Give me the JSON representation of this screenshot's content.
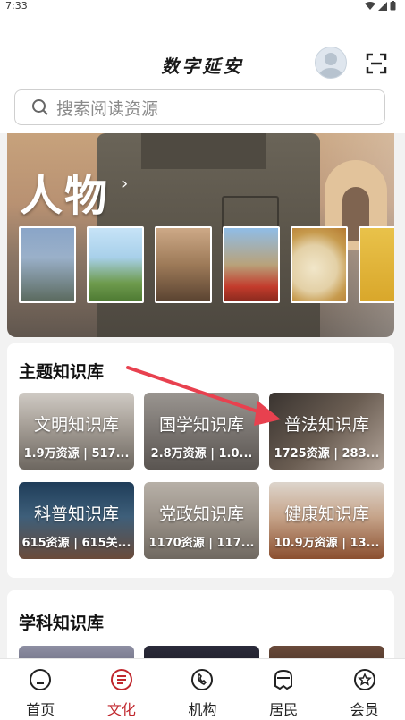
{
  "status_bar": {
    "time": "7:33"
  },
  "header": {
    "logo_text": "数字延安",
    "search_placeholder": "搜索阅读资源"
  },
  "banner": {
    "title": "人物",
    "thumbnails": [
      "portrait",
      "pagoda-hill",
      "cave-room",
      "folk-dance",
      "steamed-buns",
      "millet"
    ]
  },
  "theme_section": {
    "title": "主题知识库",
    "items": [
      {
        "name": "文明知识库",
        "meta": "1.9万资源 | 517..."
      },
      {
        "name": "国学知识库",
        "meta": "2.8万资源 | 1.0..."
      },
      {
        "name": "普法知识库",
        "meta": "1725资源 | 283..."
      },
      {
        "name": "科普知识库",
        "meta": "615资源 | 615关..."
      },
      {
        "name": "党政知识库",
        "meta": "1170资源 | 117..."
      },
      {
        "name": "健康知识库",
        "meta": "10.9万资源 | 13..."
      }
    ]
  },
  "subject_section": {
    "title": "学科知识库"
  },
  "tabbar": {
    "items": [
      {
        "label": "首页",
        "icon": "home-icon",
        "active": false
      },
      {
        "label": "文化",
        "icon": "culture-icon",
        "active": true
      },
      {
        "label": "机构",
        "icon": "phone-icon",
        "active": false
      },
      {
        "label": "居民",
        "icon": "residents-icon",
        "active": false
      },
      {
        "label": "会员",
        "icon": "member-icon",
        "active": false
      }
    ]
  },
  "colors": {
    "accent": "#c0272d",
    "annotation_arrow": "#e8414f"
  }
}
